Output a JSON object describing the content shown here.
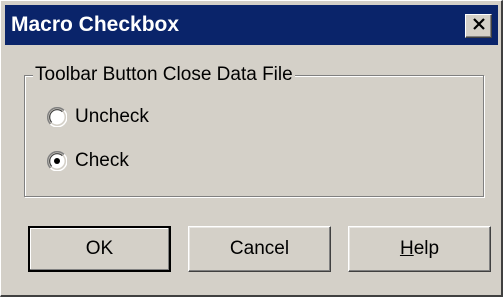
{
  "window": {
    "title": "Macro Checkbox"
  },
  "titlebar": {
    "close_icon": "close-x-icon"
  },
  "group": {
    "legend": "Toolbar Button Close Data File",
    "options": [
      {
        "label": "Uncheck",
        "selected": false
      },
      {
        "label": "Check",
        "selected": true
      }
    ]
  },
  "buttons": {
    "ok_label": "OK",
    "cancel_label": "Cancel",
    "help_label": "Help"
  },
  "colors": {
    "titlebar": "#0a246a",
    "face": "#d4d0c8"
  }
}
